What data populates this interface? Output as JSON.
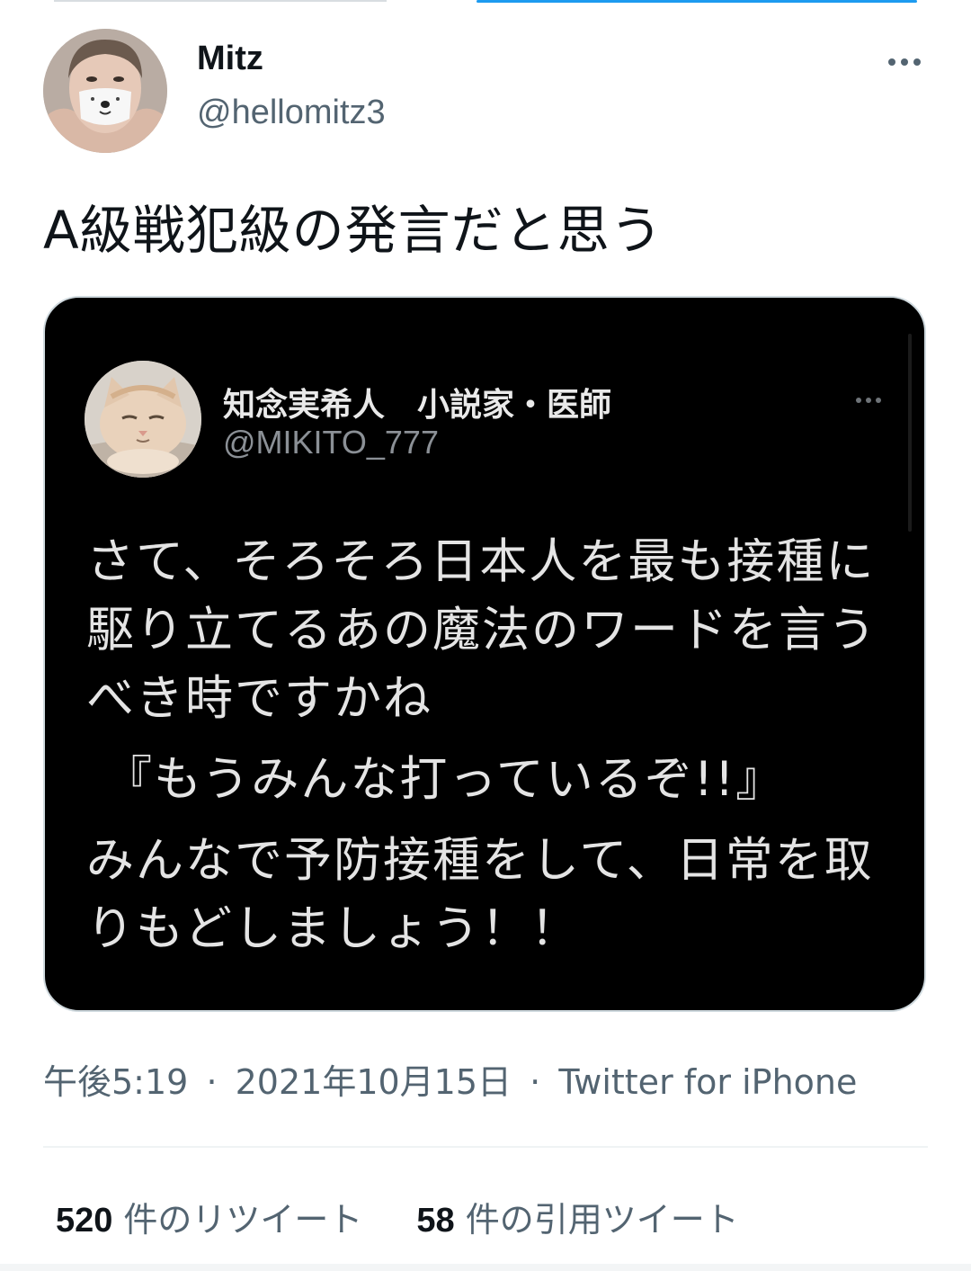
{
  "author": {
    "display_name": "Mitz",
    "handle": "@hellomitz3"
  },
  "tweet": {
    "text": "A級戦犯級の発言だと思う",
    "timestamp": "午後5:19",
    "date": "2021年10月15日",
    "source": "Twitter for iPhone",
    "separator": "·"
  },
  "quoted": {
    "display_name": "知念実希人　小説家・医師",
    "handle": "@MIKITO_777",
    "lines": [
      "さて、そろそろ日本人を最も接種に",
      "駆り立てるあの魔法のワードを言う",
      "べき時ですかね",
      "『もうみんな打っているぞ!!』",
      "みんなで予防接種をして、日常を取",
      "りもどしましょう！！"
    ]
  },
  "stats": {
    "retweets_count": "520",
    "retweets_label": "件のリツイート",
    "quotes_count": "58",
    "quotes_label": "件の引用ツイート"
  },
  "colors": {
    "accent": "#1d9bf0",
    "secondary_text": "#536471",
    "quote_background": "#000000"
  },
  "icons": {
    "more": "more-horizontal-icon"
  }
}
